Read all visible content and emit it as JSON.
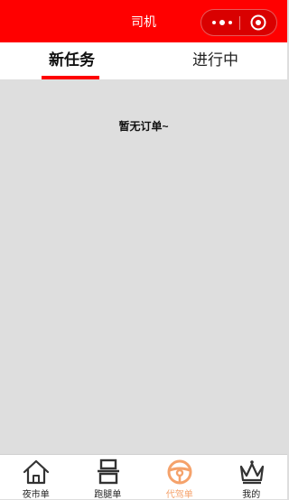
{
  "nav": {
    "title": "司机",
    "more_icon": "more-dots-icon",
    "close_icon": "target-close-icon"
  },
  "tabs": [
    {
      "label": "新任务",
      "active": true
    },
    {
      "label": "进行中",
      "active": false
    }
  ],
  "empty_message": "暂无订单~",
  "tabbar": [
    {
      "label": "夜市单",
      "icon": "home-icon",
      "active": false
    },
    {
      "label": "跑腿单",
      "icon": "runner-package-icon",
      "active": false
    },
    {
      "label": "代驾单",
      "icon": "steering-wheel-icon",
      "active": true
    },
    {
      "label": "我的",
      "icon": "crown-icon",
      "active": false
    }
  ],
  "colors": {
    "nav_bg": "#ff0000",
    "tab_indicator": "#ff0000",
    "active_tab_bar": "#f5a26b",
    "content_bg": "#dedede"
  }
}
